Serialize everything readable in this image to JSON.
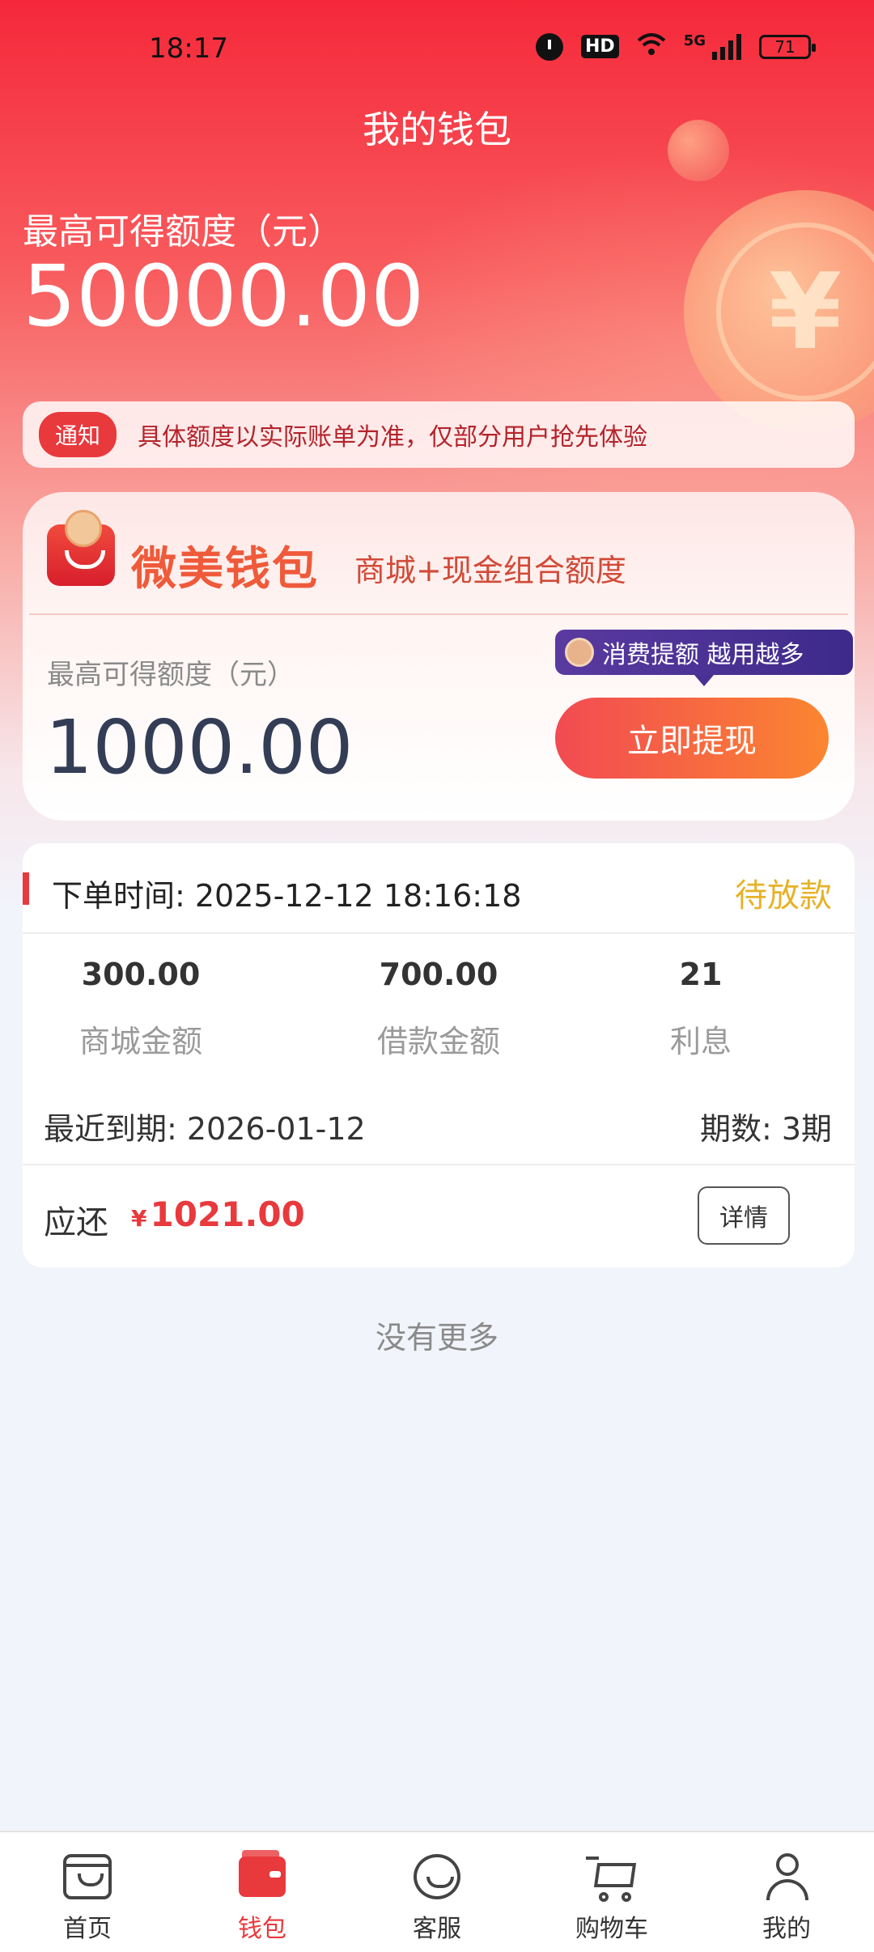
{
  "status_bar": {
    "time": "18:17",
    "hd_badge": "HD",
    "network": "5G",
    "battery": "71"
  },
  "header": {
    "title": "我的钱包"
  },
  "hero": {
    "quota_label": "最高可得额度（元）",
    "quota_value": "50000.00"
  },
  "notice": {
    "badge": "通知",
    "text": "具体额度以实际账单为准，仅部分用户抢先体验"
  },
  "wallet_card": {
    "brand": "微美钱包",
    "subtitle": "商城+现金组合额度",
    "quota_label": "最高可得额度（元）",
    "quota_value": "1000.00",
    "promo_text": "消费提额 越用越多",
    "withdraw_label": "立即提现"
  },
  "order": {
    "time_label": "下单时间: 2025-12-12 18:16:18",
    "status": "待放款",
    "stats": [
      {
        "value": "300.00",
        "label": "商城金额"
      },
      {
        "value": "700.00",
        "label": "借款金额"
      },
      {
        "value": "21",
        "label": "利息"
      }
    ],
    "due_label": "最近到期: 2026-01-12",
    "periods_label": "期数: 3期",
    "payable_label": "应还",
    "payable_currency": "¥",
    "payable_value": "1021.00",
    "detail_label": "详情"
  },
  "list_footer": {
    "no_more": "没有更多"
  },
  "tabbar": {
    "items": [
      {
        "label": "首页",
        "icon": "home-bag-icon",
        "active": false
      },
      {
        "label": "钱包",
        "icon": "wallet-icon",
        "active": true
      },
      {
        "label": "客服",
        "icon": "customer-service-icon",
        "active": false
      },
      {
        "label": "购物车",
        "icon": "shopping-cart-icon",
        "active": false
      },
      {
        "label": "我的",
        "icon": "user-icon",
        "active": false
      }
    ]
  },
  "colors": {
    "accent": "#e8393d",
    "pending_status": "#e6b228",
    "hero_gradient_top": "#f5283a",
    "withdraw_gradient_start": "#f24a52",
    "withdraw_gradient_end": "#fb8630"
  }
}
